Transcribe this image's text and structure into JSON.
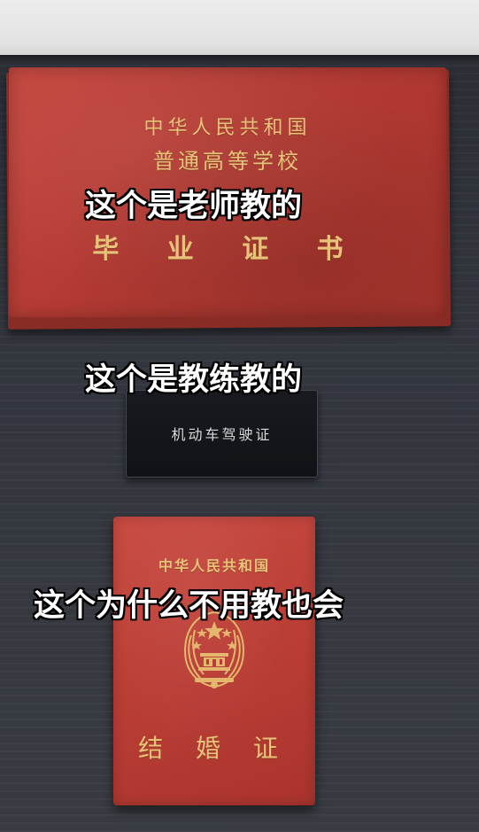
{
  "diploma": {
    "line1": "中华人民共和国",
    "line2": "普通高等学校",
    "title": "毕 业 证 书"
  },
  "license": {
    "title": "机动车驾驶证"
  },
  "marriage_certificate": {
    "line1": "中华人民共和国",
    "emblem": "national-emblem-icon",
    "title": "结 婚 证"
  },
  "captions": [
    "这个是老师教的",
    "这个是教练教的",
    "这个为什么不用教也会"
  ],
  "colors": {
    "certificate_red": "#b93d35",
    "gold_text": "#e8c27a",
    "license_black": "#14161b",
    "caption_text": "#ffffff",
    "caption_outline": "#000000"
  }
}
